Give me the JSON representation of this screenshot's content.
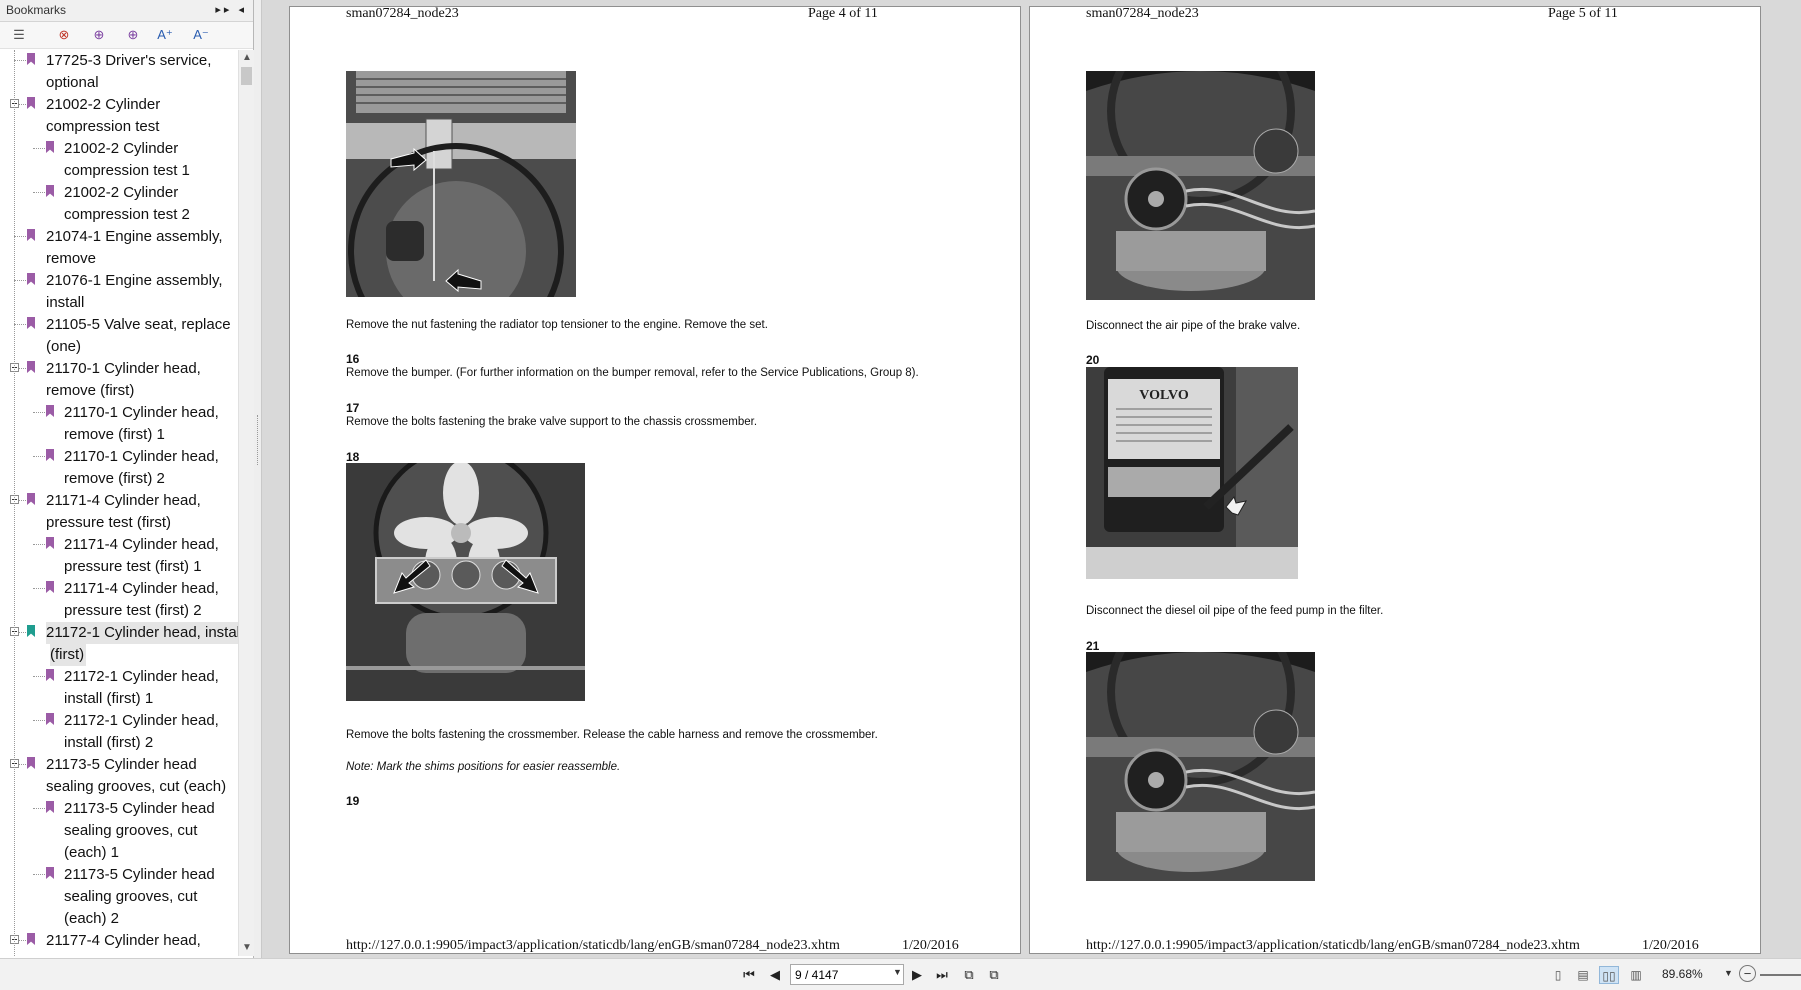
{
  "sidebar": {
    "title": "Bookmarks",
    "toolbar": [
      {
        "icon": "options-icon",
        "glyph": "☰"
      },
      {
        "icon": "delete-bookmark-icon",
        "glyph": "⊗"
      },
      {
        "icon": "add-bookmark-icon",
        "glyph": "⊕"
      },
      {
        "icon": "add-child-bookmark-icon",
        "glyph": "⊕"
      },
      {
        "icon": "increase-font-icon",
        "glyph": "A⁺"
      },
      {
        "icon": "decrease-font-icon",
        "glyph": "A⁻"
      }
    ],
    "bookmarks": [
      {
        "level": 0,
        "lines": [
          "17725-3 Driver's service,",
          "optional"
        ],
        "expandable": false
      },
      {
        "level": 0,
        "lines": [
          "21002-2 Cylinder",
          "compression test"
        ],
        "expandable": true
      },
      {
        "level": 1,
        "lines": [
          "21002-2 Cylinder",
          "compression test 1"
        ]
      },
      {
        "level": 1,
        "lines": [
          "21002-2 Cylinder",
          "compression test 2"
        ]
      },
      {
        "level": 0,
        "lines": [
          "21074-1 Engine assembly,",
          "remove"
        ],
        "expandable": false
      },
      {
        "level": 0,
        "lines": [
          "21076-1 Engine assembly,",
          "install"
        ],
        "expandable": false
      },
      {
        "level": 0,
        "lines": [
          "21105-5 Valve seat, replace",
          "(one)"
        ],
        "expandable": false
      },
      {
        "level": 0,
        "lines": [
          "21170-1 Cylinder head,",
          "remove (first)"
        ],
        "expandable": true
      },
      {
        "level": 1,
        "lines": [
          "21170-1 Cylinder head,",
          "remove (first) 1"
        ]
      },
      {
        "level": 1,
        "lines": [
          "21170-1 Cylinder head,",
          "remove (first) 2"
        ]
      },
      {
        "level": 0,
        "lines": [
          "21171-4 Cylinder head,",
          "pressure test (first)"
        ],
        "expandable": true
      },
      {
        "level": 1,
        "lines": [
          "21171-4 Cylinder head,",
          "pressure test (first) 1"
        ]
      },
      {
        "level": 1,
        "lines": [
          "21171-4 Cylinder head,",
          "pressure test (first) 2"
        ]
      },
      {
        "level": 0,
        "lines": [
          "21172-1 Cylinder head, install",
          "(first)"
        ],
        "expandable": true,
        "selected": true
      },
      {
        "level": 1,
        "lines": [
          "21172-1 Cylinder head,",
          "install (first) 1"
        ]
      },
      {
        "level": 1,
        "lines": [
          "21172-1 Cylinder head,",
          "install (first) 2"
        ]
      },
      {
        "level": 0,
        "lines": [
          "21173-5 Cylinder head",
          "sealing grooves, cut (each)"
        ],
        "expandable": true
      },
      {
        "level": 1,
        "lines": [
          "21173-5 Cylinder head",
          "sealing grooves, cut",
          "(each) 1"
        ]
      },
      {
        "level": 1,
        "lines": [
          "21173-5 Cylinder head",
          "sealing grooves, cut",
          "(each) 2"
        ]
      },
      {
        "level": 0,
        "lines": [
          "21177-4 Cylinder head,",
          ""
        ],
        "expandable": true
      }
    ]
  },
  "pages": [
    {
      "header_left": "sman07284_node23",
      "header_right": "Page 4 of 11",
      "texts": [
        "Remove the nut fastening the radiator top tensioner to the engine. Remove the set.",
        "Remove the bumper. (For further information on the bumper removal, refer to the Service Publications, Group 8).",
        "Remove the bolts fastening the brake valve support to the chassis crossmember.",
        "Remove the bolts fastening the crossmember. Release the cable harness and remove the crossmember."
      ],
      "steps": [
        "16",
        "17",
        "18",
        "19"
      ],
      "note": "Note: Mark the shims positions for easier reassemble.",
      "footer_url": "http://127.0.0.1:9905/impact3/application/staticdb/lang/enGB/sman07284_node23.xhtm",
      "footer_date": "1/20/2016"
    },
    {
      "header_left": "sman07284_node23",
      "header_right": "Page 5 of 11",
      "texts": [
        "Disconnect the air pipe of the brake valve.",
        "Disconnect the diesel oil pipe of the feed pump in the filter."
      ],
      "steps": [
        "20",
        "21"
      ],
      "photo_label": "VOLVO",
      "footer_url": "http://127.0.0.1:9905/impact3/application/staticdb/lang/enGB/sman07284_node23.xhtm",
      "footer_date": "1/20/2016"
    }
  ],
  "statusbar": {
    "page_value": "9 / 4147",
    "zoom": "89.68%"
  },
  "colors": {
    "bookmark": "#9b5ca6",
    "bookmark_active": "#1f9d8f",
    "selected_row": "#e5e5e5"
  }
}
